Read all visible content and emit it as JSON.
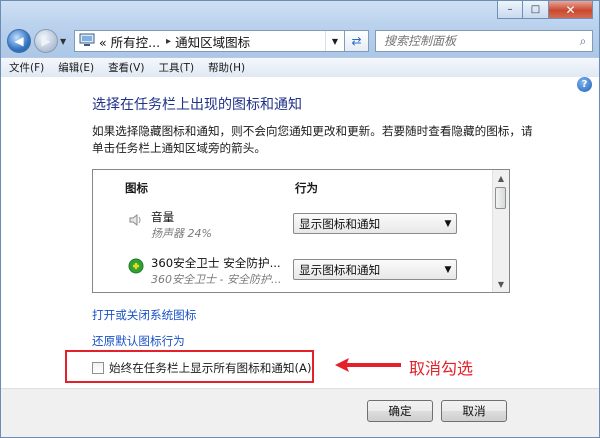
{
  "window": {
    "caption": {
      "minimize": "–",
      "maximize": "□",
      "close": "✕"
    }
  },
  "address": {
    "crumbs": [
      "«  所有控...",
      "通知区域图标"
    ],
    "separator": "▸"
  },
  "search": {
    "placeholder": "搜索控制面板"
  },
  "menu": [
    "文件(F)",
    "编辑(E)",
    "查看(V)",
    "工具(T)",
    "帮助(H)"
  ],
  "content": {
    "title": "选择在任务栏上出现的图标和通知",
    "description": "如果选择隐藏图标和通知，则不会向您通知更改和更新。若要随时查看隐藏的图标，请单击任务栏上通知区域旁的箭头。",
    "list": {
      "col_icon": "图标",
      "col_behavior": "行为",
      "rows": [
        {
          "name": "音量",
          "sub": "扬声器 24%",
          "behavior": "显示图标和通知"
        },
        {
          "name": "360安全卫士 安全防护...",
          "sub": "360安全卫士 - 安全防护...",
          "behavior": "显示图标和通知"
        }
      ]
    },
    "link_system_icons": "打开或关闭系统图标",
    "link_restore": "还原默认图标行为",
    "always_show_label": "始终在任务栏上显示所有图标和通知(A)",
    "always_show_checked": false,
    "annotation": "取消勾选",
    "annotation_color": "#e4202a"
  },
  "footer": {
    "ok": "确定",
    "cancel": "取消"
  }
}
